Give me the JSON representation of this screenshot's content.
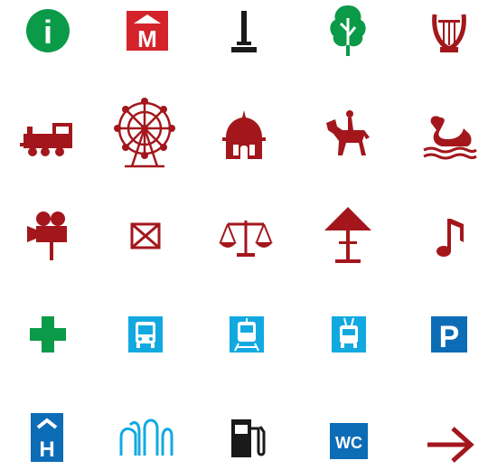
{
  "colors": {
    "green": "#0a9a48",
    "red": "#a3171c",
    "bright_red": "#d4232a",
    "black": "#1a1a1a",
    "cyan": "#12a9e1",
    "blue": "#0d6cb6",
    "white": "#ffffff"
  },
  "icons": [
    {
      "name": "information-icon",
      "label": "i"
    },
    {
      "name": "metro-icon",
      "label": "M"
    },
    {
      "name": "monument-icon"
    },
    {
      "name": "tree-icon"
    },
    {
      "name": "lyre-icon"
    },
    {
      "name": "steam-train-icon"
    },
    {
      "name": "ferris-wheel-icon"
    },
    {
      "name": "church-dome-icon"
    },
    {
      "name": "equestrian-statue-icon"
    },
    {
      "name": "swan-icon"
    },
    {
      "name": "movie-camera-icon"
    },
    {
      "name": "post-box-icon"
    },
    {
      "name": "scales-of-justice-icon"
    },
    {
      "name": "pavilion-icon"
    },
    {
      "name": "music-note-icon"
    },
    {
      "name": "pharmacy-cross-icon"
    },
    {
      "name": "bus-icon"
    },
    {
      "name": "tram-icon"
    },
    {
      "name": "trolleybus-icon"
    },
    {
      "name": "parking-icon",
      "label": "P"
    },
    {
      "name": "hotel-icon",
      "label": "H"
    },
    {
      "name": "fountain-icon"
    },
    {
      "name": "fuel-station-icon"
    },
    {
      "name": "toilet-icon",
      "label": "WC"
    },
    {
      "name": "arrow-right-icon"
    }
  ]
}
